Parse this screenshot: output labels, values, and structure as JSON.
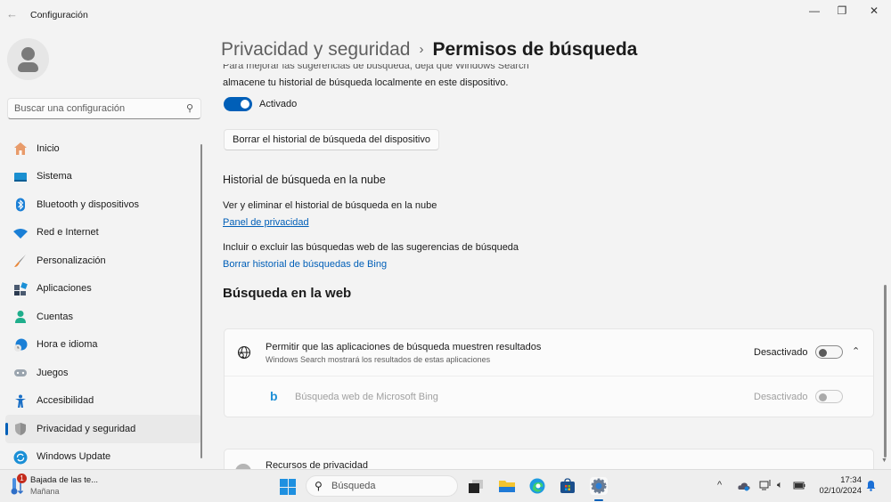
{
  "window": {
    "title": "Configuración",
    "controls": {
      "minimize": "—",
      "maximize": "❐",
      "close": "✕"
    }
  },
  "sidebar": {
    "search": {
      "placeholder": "Buscar una configuración",
      "value": ""
    },
    "items": [
      {
        "label": "Inicio",
        "icon": "home-icon",
        "active": false
      },
      {
        "label": "Sistema",
        "icon": "system-icon",
        "active": false
      },
      {
        "label": "Bluetooth y dispositivos",
        "icon": "bluetooth-icon",
        "active": false
      },
      {
        "label": "Red e Internet",
        "icon": "wifi-icon",
        "active": false
      },
      {
        "label": "Personalización",
        "icon": "brush-icon",
        "active": false
      },
      {
        "label": "Aplicaciones",
        "icon": "apps-icon",
        "active": false
      },
      {
        "label": "Cuentas",
        "icon": "account-icon",
        "active": false
      },
      {
        "label": "Hora e idioma",
        "icon": "time-language-icon",
        "active": false
      },
      {
        "label": "Juegos",
        "icon": "gamepad-icon",
        "active": false
      },
      {
        "label": "Accesibilidad",
        "icon": "accessibility-icon",
        "active": false
      },
      {
        "label": "Privacidad y seguridad",
        "icon": "shield-icon",
        "active": true
      },
      {
        "label": "Windows Update",
        "icon": "update-icon",
        "active": false
      }
    ]
  },
  "breadcrumb": {
    "parent": "Privacidad y seguridad",
    "separator": "›",
    "current": "Permisos de búsqueda"
  },
  "content": {
    "clipped_line": "Para mejorar las sugerencias de búsqueda, deja que Windows Search",
    "description": "almacene tu historial de búsqueda localmente en este dispositivo.",
    "history_toggle": {
      "state": "on",
      "label": "Activado"
    },
    "clear_device_button": "Borrar el historial de búsqueda del dispositivo",
    "cloud_section": {
      "title": "Historial de búsqueda en la nube",
      "view_text": "Ver y eliminar el historial de búsqueda en la nube",
      "privacy_link": "Panel de privacidad",
      "include_text": "Incluir o excluir las búsquedas web de las sugerencias de búsqueda",
      "bing_link": "Borrar historial de búsquedas de Bing"
    },
    "web_section": {
      "title": "Búsqueda en la web",
      "allow_apps": {
        "title": "Permitir que las aplicaciones de búsqueda muestren resultados",
        "subtitle": "Windows Search mostrará los resultados de estas aplicaciones",
        "status": "Desactivado",
        "toggle": "off",
        "expanded": true
      },
      "bing_web": {
        "title": "Búsqueda web de Microsoft Bing",
        "status": "Desactivado",
        "toggle": "off",
        "disabled": true
      }
    },
    "privacy_resources": {
      "title": "Recursos de privacidad"
    }
  },
  "taskbar": {
    "weather": {
      "title": "Bajada de las te...",
      "subtitle": "Mañana",
      "badge": "1"
    },
    "search_label": "Búsqueda",
    "apps": [
      "task-view",
      "file-explorer",
      "edge",
      "store",
      "settings"
    ],
    "tray": {
      "chevron": "^",
      "time": "17:34",
      "date": "02/10/2024"
    }
  }
}
